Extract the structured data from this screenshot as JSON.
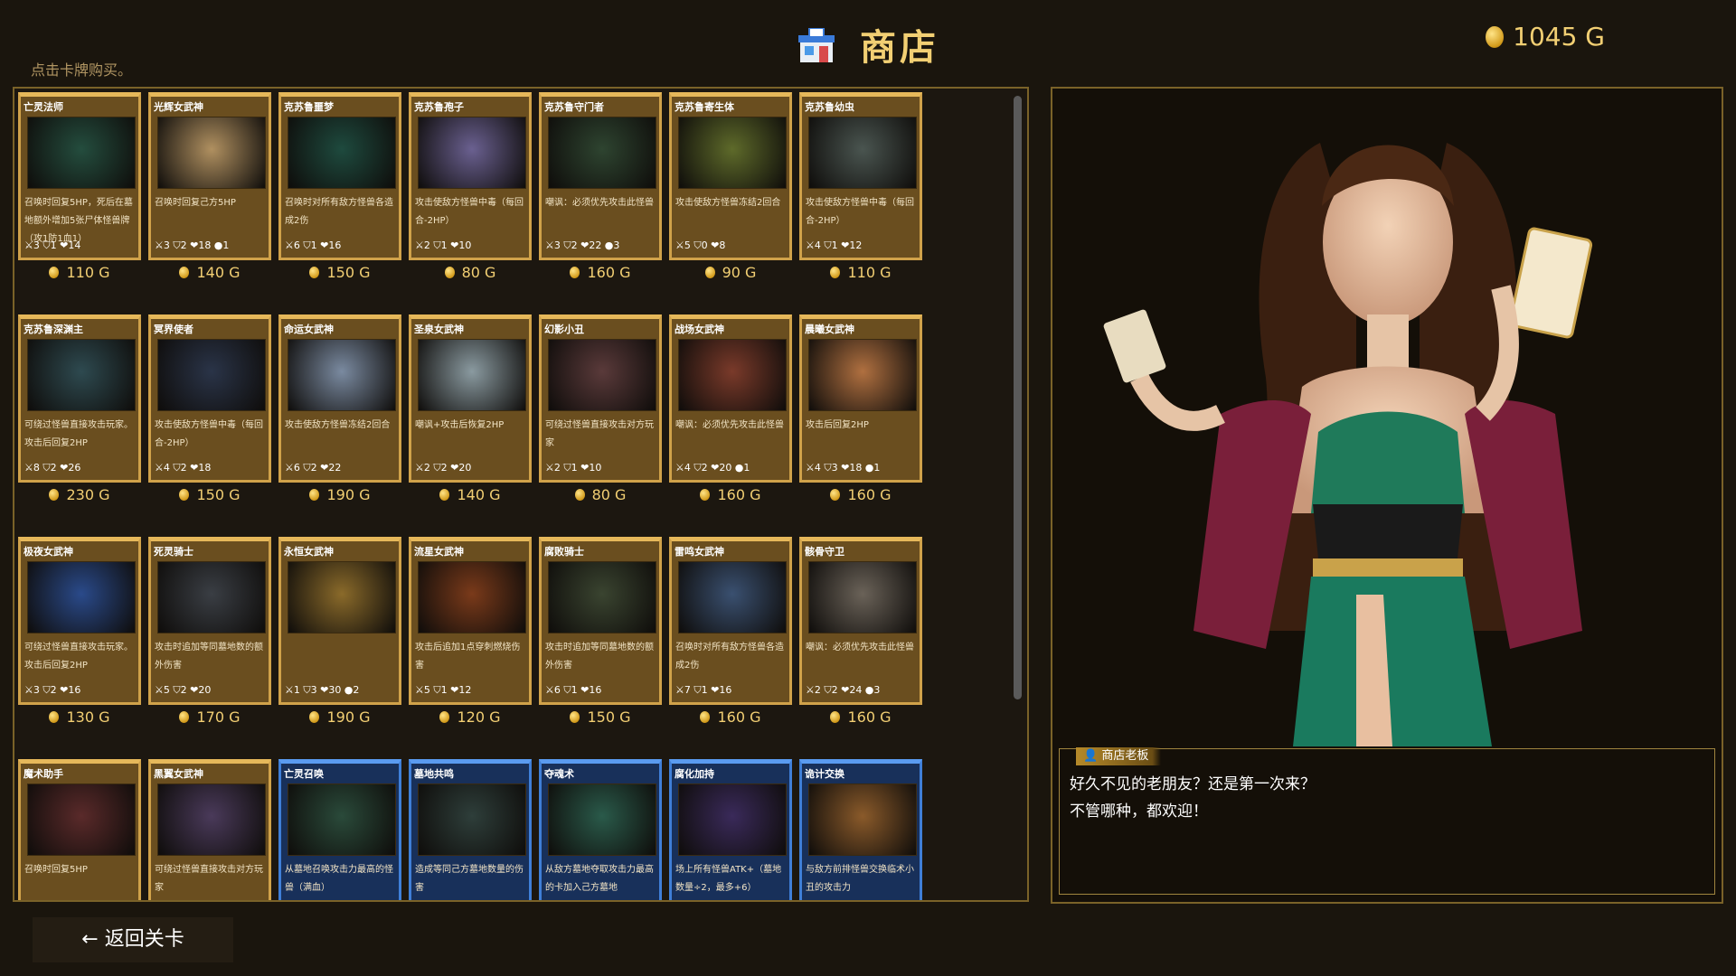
{
  "header": {
    "title": "商店",
    "gold": "1045 G",
    "hint": "点击卡牌购买。"
  },
  "cards": [
    {
      "name": "亡灵法师",
      "desc": "召唤时回复5HP，死后在墓地额外增加5张尸体怪兽牌（攻1防1血1）",
      "stats": "⚔3 ⛉1 ❤14",
      "price": "110 G",
      "type": "monster",
      "art": "#244d3e"
    },
    {
      "name": "光辉女武神",
      "desc": "召唤时回复己方5HP",
      "stats": "⚔3 ⛉2 ❤18 ●1",
      "price": "140 G",
      "type": "monster",
      "art": "#b09060"
    },
    {
      "name": "克苏鲁噩梦",
      "desc": "召唤时对所有敌方怪兽各造成2伤",
      "stats": "⚔6 ⛉1 ❤16",
      "price": "150 G",
      "type": "monster",
      "art": "#1e4a3e"
    },
    {
      "name": "克苏鲁孢子",
      "desc": "攻击使敌方怪兽中毒（每回合-2HP）",
      "stats": "⚔2 ⛉1 ❤10",
      "price": "80 G",
      "type": "monster",
      "art": "#6a6090"
    },
    {
      "name": "克苏鲁守门者",
      "desc": "嘲讽：必须优先攻击此怪兽",
      "stats": "⚔3 ⛉2 ❤22 ●3",
      "price": "160 G",
      "type": "monster",
      "art": "#2e4430"
    },
    {
      "name": "克苏鲁寄生体",
      "desc": "攻击使敌方怪兽冻结2回合",
      "stats": "⚔5 ⛉0 ❤8",
      "price": "90 G",
      "type": "monster",
      "art": "#5e6a2a"
    },
    {
      "name": "克苏鲁幼虫",
      "desc": "攻击使敌方怪兽中毒（每回合-2HP）",
      "stats": "⚔4 ⛉1 ❤12",
      "price": "110 G",
      "type": "monster",
      "art": "#4a5550"
    },
    {
      "name": "克苏鲁深渊主",
      "desc": "可绕过怪兽直接攻击玩家。攻击后回复2HP",
      "stats": "⚔8 ⛉2 ❤26",
      "price": "230 G",
      "type": "monster",
      "art": "#2e4a50"
    },
    {
      "name": "冥界使者",
      "desc": "攻击使敌方怪兽中毒（每回合-2HP）",
      "stats": "⚔4 ⛉2 ❤18",
      "price": "150 G",
      "type": "monster",
      "art": "#2a3448"
    },
    {
      "name": "命运女武神",
      "desc": "攻击使敌方怪兽冻结2回合",
      "stats": "⚔6 ⛉2 ❤22",
      "price": "190 G",
      "type": "monster",
      "art": "#7a8aa0"
    },
    {
      "name": "圣泉女武神",
      "desc": "嘲讽+攻击后恢复2HP",
      "stats": "⚔2 ⛉2 ❤20",
      "price": "140 G",
      "type": "monster",
      "art": "#8a9aa0"
    },
    {
      "name": "幻影小丑",
      "desc": "可绕过怪兽直接攻击对方玩家",
      "stats": "⚔2 ⛉1 ❤10",
      "price": "80 G",
      "type": "monster",
      "art": "#5a3a3a"
    },
    {
      "name": "战场女武神",
      "desc": "嘲讽：必须优先攻击此怪兽",
      "stats": "⚔4 ⛉2 ❤20 ●1",
      "price": "160 G",
      "type": "monster",
      "art": "#7a3a2a"
    },
    {
      "name": "晨曦女武神",
      "desc": "攻击后回复2HP",
      "stats": "⚔4 ⛉3 ❤18 ●1",
      "price": "160 G",
      "type": "monster",
      "art": "#b07040"
    },
    {
      "name": "极夜女武神",
      "desc": "可绕过怪兽直接攻击玩家。攻击后回复2HP",
      "stats": "⚔3 ⛉2 ❤16",
      "price": "130 G",
      "type": "monster",
      "art": "#2a4a8a"
    },
    {
      "name": "死灵骑士",
      "desc": "攻击时追加等同墓地数的额外伤害",
      "stats": "⚔5 ⛉2 ❤20",
      "price": "170 G",
      "type": "monster",
      "art": "#3a3e44"
    },
    {
      "name": "永恒女武神",
      "desc": "",
      "stats": "⚔1 ⛉3 ❤30 ●2",
      "price": "190 G",
      "type": "monster",
      "art": "#8a6a2a"
    },
    {
      "name": "流星女武神",
      "desc": "攻击后追加1点穿刺燃烧伤害",
      "stats": "⚔5 ⛉1 ❤12",
      "price": "120 G",
      "type": "monster",
      "art": "#7a3a1a"
    },
    {
      "name": "腐败骑士",
      "desc": "攻击时追加等同墓地数的额外伤害",
      "stats": "⚔6 ⛉1 ❤16",
      "price": "150 G",
      "type": "monster",
      "art": "#3a4430"
    },
    {
      "name": "雷鸣女武神",
      "desc": "召唤时对所有敌方怪兽各造成2伤",
      "stats": "⚔7 ⛉1 ❤16",
      "price": "160 G",
      "type": "monster",
      "art": "#3a5070"
    },
    {
      "name": "骸骨守卫",
      "desc": "嘲讽：必须优先攻击此怪兽",
      "stats": "⚔2 ⛉2 ❤24 ●3",
      "price": "160 G",
      "type": "monster",
      "art": "#6a6258"
    },
    {
      "name": "魔术助手",
      "desc": "召唤时回复5HP",
      "stats": "",
      "price": "",
      "type": "monster",
      "art": "#5a2a2a"
    },
    {
      "name": "黑翼女武神",
      "desc": "可绕过怪兽直接攻击对方玩家",
      "stats": "",
      "price": "",
      "type": "monster",
      "art": "#4a3a5a"
    },
    {
      "name": "亡灵召唤",
      "desc": "从墓地召唤攻击力最高的怪兽（满血）",
      "stats": "",
      "price": "",
      "type": "spell",
      "art": "#2a4a3a"
    },
    {
      "name": "墓地共鸣",
      "desc": "造成等同己方墓地数量的伤害",
      "stats": "",
      "price": "",
      "type": "spell",
      "art": "#2e3e3a"
    },
    {
      "name": "夺魂术",
      "desc": "从敌方墓地夺取攻击力最高的卡加入己方墓地",
      "stats": "",
      "price": "",
      "type": "spell",
      "art": "#2a5a4a"
    },
    {
      "name": "腐化加持",
      "desc": "场上所有怪兽ATK+（墓地数量÷2，最多+6）",
      "stats": "",
      "price": "",
      "type": "spell",
      "art": "#3a2a5a"
    },
    {
      "name": "诡计交换",
      "desc": "与敌方前排怪兽交换临术小丑的攻击力",
      "stats": "",
      "price": "",
      "type": "spell",
      "art": "#8a5a2a"
    }
  ],
  "dialog": {
    "speaker": "商店老板",
    "lines": [
      "好久不见的老朋友？还是第一次来？",
      "不管哪种，都欢迎！"
    ]
  },
  "back_button": "← 返回关卡"
}
